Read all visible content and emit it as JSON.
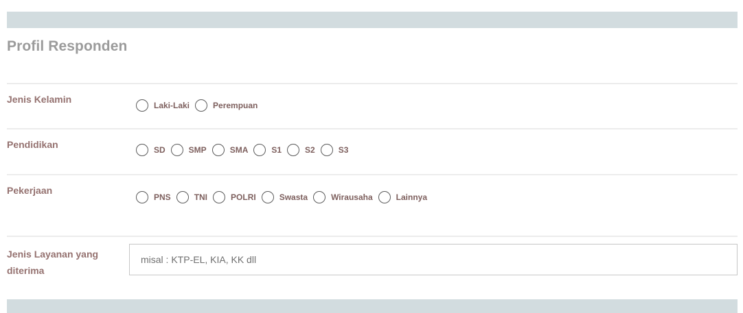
{
  "section": {
    "title": "Profil Responden"
  },
  "gender": {
    "label": "Jenis Kelamin",
    "options": [
      "Laki-Laki",
      "Perempuan"
    ]
  },
  "education": {
    "label": "Pendidikan",
    "options": [
      "SD",
      "SMP",
      "SMA",
      "S1",
      "S2",
      "S3"
    ]
  },
  "job": {
    "label": "Pekerjaan",
    "options": [
      "PNS",
      "TNI",
      "POLRI",
      "Swasta",
      "Wirausaha",
      "Lainnya"
    ]
  },
  "service": {
    "label": "Jenis Layanan yang diterima",
    "placeholder": "misal : KTP-EL, KIA, KK dll",
    "value": ""
  }
}
